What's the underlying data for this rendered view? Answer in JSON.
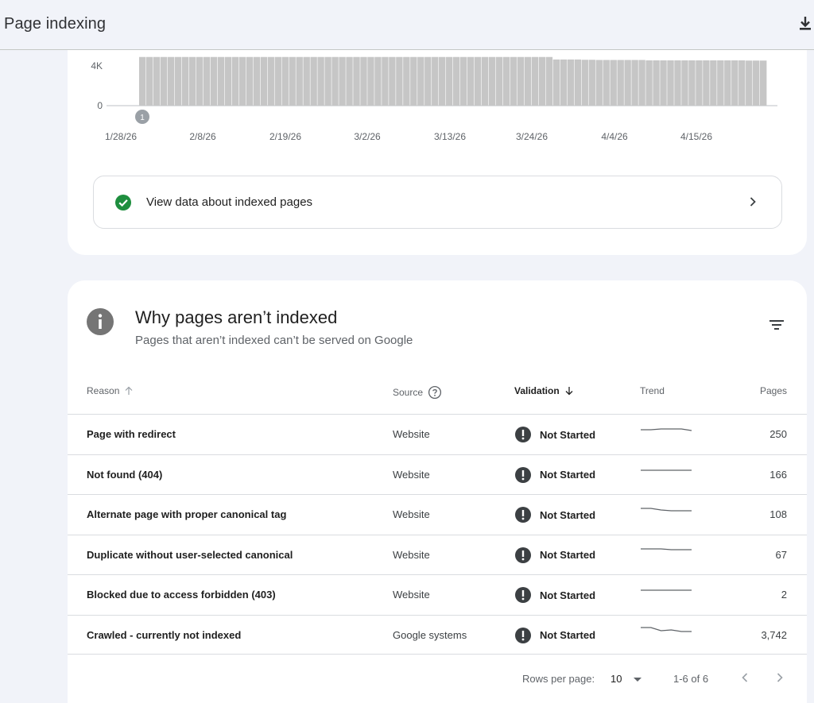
{
  "header": {
    "title": "Page indexing",
    "download_icon": "download-icon"
  },
  "chart_data": {
    "type": "bar",
    "ylabel": "",
    "xlabel": "",
    "yticks": [
      "4K",
      "0"
    ],
    "y_tick_values": [
      4000,
      0
    ],
    "xticks": [
      "1/28/26",
      "2/8/26",
      "2/19/26",
      "3/2/26",
      "3/13/26",
      "3/24/26",
      "4/4/26",
      "4/15/26"
    ],
    "annotation": "1",
    "bar_color": "#c6c6c6",
    "series": [
      {
        "values": [
          4900,
          4900,
          4900,
          4900,
          4900,
          4900,
          4900,
          4900,
          4900,
          4900,
          4900,
          4900,
          4900,
          4900,
          4900,
          4900,
          4900,
          4900,
          4900,
          4900,
          4900,
          4900,
          4900,
          4900,
          4900,
          4900,
          4900,
          4900,
          4900,
          4900,
          4900,
          4900,
          4900,
          4900,
          4900,
          4900,
          4900,
          4900,
          4900,
          4900,
          4900,
          4900,
          4900,
          4900,
          4900,
          4900,
          4900,
          4900,
          4900,
          4900,
          4900,
          4900,
          4900,
          4900,
          4900,
          4900,
          4900,
          4900,
          4650,
          4650,
          4650,
          4650,
          4620,
          4620,
          4600,
          4600,
          4600,
          4600,
          4600,
          4600,
          4600,
          4560,
          4560,
          4560,
          4560,
          4560,
          4560,
          4560,
          4560,
          4560,
          4560,
          4560,
          4560,
          4560,
          4560,
          4540,
          4540,
          4540
        ]
      }
    ]
  },
  "indexed_link": {
    "label": "View data about indexed pages",
    "icon": "check-circle-icon",
    "color": "#1e8e3e"
  },
  "not_indexed": {
    "title": "Why pages aren’t indexed",
    "subtitle": "Pages that aren’t indexed can’t be served on Google",
    "icon": "info-icon",
    "columns": {
      "reason": "Reason",
      "source": "Source",
      "validation": "Validation",
      "trend": "Trend",
      "pages": "Pages"
    },
    "rows": [
      {
        "reason": "Page with redirect",
        "source": "Website",
        "validation": "Not Started",
        "pages": "250",
        "trend": [
          5,
          5,
          4,
          4,
          4,
          6
        ]
      },
      {
        "reason": "Not found (404)",
        "source": "Website",
        "validation": "Not Started",
        "pages": "166",
        "trend": [
          5,
          5,
          5,
          5,
          5,
          5
        ]
      },
      {
        "reason": "Alternate page with proper canonical tag",
        "source": "Website",
        "validation": "Not Started",
        "pages": "108",
        "trend": [
          3,
          3,
          5,
          6,
          6,
          6
        ]
      },
      {
        "reason": "Duplicate without user-selected canonical",
        "source": "Website",
        "validation": "Not Started",
        "pages": "67",
        "trend": [
          3,
          3,
          3,
          4,
          4,
          4
        ]
      },
      {
        "reason": "Blocked due to access forbidden (403)",
        "source": "Website",
        "validation": "Not Started",
        "pages": "2",
        "trend": [
          5,
          5,
          5,
          5,
          5,
          5
        ]
      },
      {
        "reason": "Crawled - currently not indexed",
        "source": "Google systems",
        "validation": "Not Started",
        "pages": "3,742",
        "trend": [
          1,
          1,
          5,
          4,
          6,
          6
        ]
      }
    ],
    "status_color": "#3c4043"
  },
  "pagination": {
    "rows_per_page_label": "Rows per page:",
    "rows_per_page_value": "10",
    "range": "1-6 of 6"
  }
}
